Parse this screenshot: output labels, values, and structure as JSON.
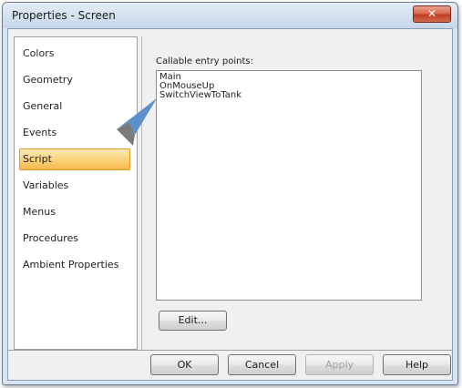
{
  "window": {
    "title": "Properties - Screen",
    "close_glyph": "✕"
  },
  "nav": {
    "items": [
      {
        "label": "Colors"
      },
      {
        "label": "Geometry"
      },
      {
        "label": "General"
      },
      {
        "label": "Events"
      },
      {
        "label": "Script",
        "selected": true
      },
      {
        "label": "Variables"
      },
      {
        "label": "Menus"
      },
      {
        "label": "Procedures"
      },
      {
        "label": "Ambient Properties"
      }
    ]
  },
  "script_panel": {
    "entry_points_label": "Callable entry points:",
    "entry_points": [
      "Main",
      "OnMouseUp",
      "SwitchViewToTank"
    ],
    "edit_label": "Edit..."
  },
  "footer": {
    "ok_label": "OK",
    "cancel_label": "Cancel",
    "apply_label": "Apply",
    "help_label": "Help"
  },
  "colors": {
    "selection_fill": "#fbd37e",
    "selection_border": "#e09a2c",
    "close_button": "#c03e23",
    "annotation_arrow": "#5b8fc9"
  },
  "icons": {
    "close": "close-icon",
    "annotation": "pointer-arrow-icon"
  }
}
